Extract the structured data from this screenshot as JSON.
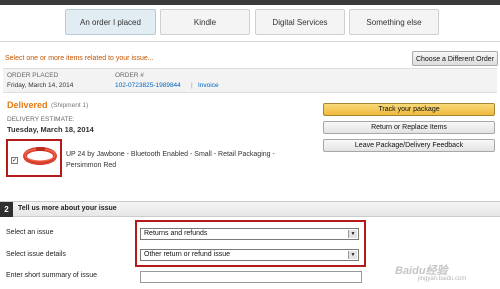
{
  "tabs": [
    "An order I placed",
    "Kindle",
    "Digital Services",
    "Something else"
  ],
  "instruction": "Select one or more items related to your issue...",
  "change_order_button": "Choose a Different Order",
  "order": {
    "placed_label": "ORDER PLACED",
    "placed_value": "Friday, March 14, 2014",
    "number_label": "ORDER #",
    "number_value": "102-0723825-1989844",
    "invoice_link": "Invoice"
  },
  "shipment": {
    "status": "Delivered",
    "shipment_note": "(Shipment 1)",
    "estimate_label": "DELIVERY ESTIMATE:",
    "estimate_value": "Tuesday, March 18, 2014"
  },
  "actions": [
    "Track your package",
    "Return or Replace Items",
    "Leave Package/Delivery Feedback"
  ],
  "item": {
    "checked": true,
    "checkbox_mark": "✓",
    "title": "UP 24 by Jawbone - Bluetooth Enabled - Small - Retail Packaging - Persimmon Red"
  },
  "section": {
    "number": "2",
    "title": "Tell us more about your issue"
  },
  "form": {
    "issue_label": "Select an issue",
    "issue_value": "Returns and refunds",
    "details_label": "Select issue details",
    "details_value": "Other return or refund issue",
    "summary_label": "Enter short summary of issue"
  },
  "select_arrow": "▼",
  "watermark": {
    "main": "Baidu经验",
    "sub": "jingyan.baidu.com"
  },
  "colors": {
    "accent_orange": "#e47911",
    "link_blue": "#0066c0",
    "highlight_red": "#b31b1b",
    "primary_button": "#f0b93c"
  },
  "icons": [
    "fitness-band-image",
    "checkbox-check-icon",
    "dropdown-arrow-icon"
  ]
}
